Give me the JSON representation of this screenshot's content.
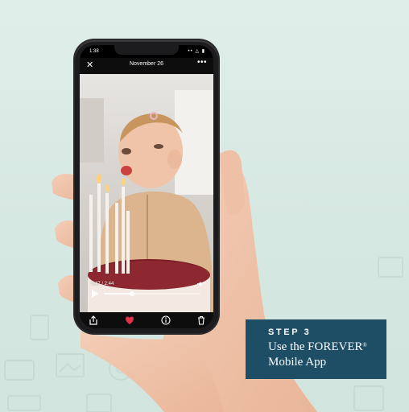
{
  "status_bar": {
    "time": "1:38",
    "icons": "•• △ ▮"
  },
  "header": {
    "close_icon": "✕",
    "title": "November 26",
    "more_icon": "•••"
  },
  "video": {
    "time": "0:47 / 2:44",
    "volume_icon": "🔈",
    "progress": 0.29
  },
  "actions": [
    "share-icon",
    "heart-icon",
    "info-icon",
    "trash-icon"
  ],
  "colors": {
    "card": "#1e4d66",
    "heart": "#e2324a",
    "background": "#d6e8e2"
  },
  "card": {
    "step": "STEP 3",
    "line1_prefix": "Use the FOREVER",
    "line1_mark": "®",
    "line2": "Mobile App"
  }
}
